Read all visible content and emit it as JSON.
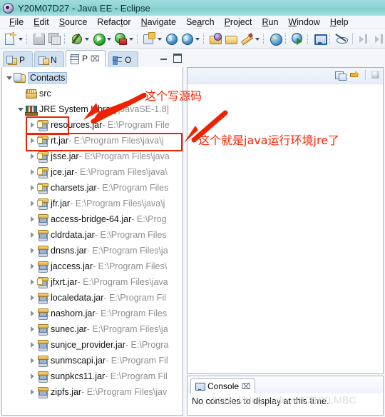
{
  "window": {
    "title": "Y20M07D27 - Java EE - Eclipse",
    "app_icon": "eclipse-icon"
  },
  "menubar": {
    "items": [
      {
        "label": "File",
        "mnemonic": "F"
      },
      {
        "label": "Edit",
        "mnemonic": "E"
      },
      {
        "label": "Source",
        "mnemonic": "S"
      },
      {
        "label": "Refactor",
        "mnemonic": "t"
      },
      {
        "label": "Navigate",
        "mnemonic": "N"
      },
      {
        "label": "Search",
        "mnemonic": "a"
      },
      {
        "label": "Project",
        "mnemonic": "P"
      },
      {
        "label": "Run",
        "mnemonic": "R"
      },
      {
        "label": "Window",
        "mnemonic": "W"
      },
      {
        "label": "Help",
        "mnemonic": "H"
      }
    ]
  },
  "toolbar": {
    "items": [
      {
        "name": "new-file-button",
        "icon": "new-file-icon"
      },
      {
        "name": "new-file-dropdown",
        "icon": "chevron-down-icon"
      },
      {
        "name": "save-button",
        "icon": "save-icon"
      },
      {
        "name": "save-all-button",
        "icon": "save-all-icon"
      },
      {
        "name": "debug-button",
        "icon": "debug-bug-icon"
      },
      {
        "name": "debug-dropdown",
        "icon": "chevron-down-icon"
      },
      {
        "name": "run-button",
        "icon": "run-play-icon"
      },
      {
        "name": "run-dropdown",
        "icon": "chevron-down-icon"
      },
      {
        "name": "run-on-server-button",
        "icon": "run-server-icon"
      },
      {
        "name": "run-on-server-dropdown",
        "icon": "chevron-down-icon"
      },
      {
        "name": "new-web-project-button",
        "icon": "new-web-icon"
      },
      {
        "name": "new-web-project-dropdown",
        "icon": "chevron-down-icon"
      },
      {
        "name": "search-button",
        "icon": "search-globe-icon"
      },
      {
        "name": "search-dropdown",
        "icon": "chevron-down-icon"
      },
      {
        "name": "open-type-button",
        "icon": "open-folder-icon"
      },
      {
        "name": "open-resource-button",
        "icon": "folder-icon"
      },
      {
        "name": "annotation-button",
        "icon": "pencil-icon"
      },
      {
        "name": "annotation-dropdown",
        "icon": "chevron-down-icon"
      },
      {
        "name": "web-browser-button",
        "icon": "globe-icon"
      },
      {
        "name": "external-browser-button",
        "icon": "external-browser-icon"
      },
      {
        "name": "console-button",
        "icon": "monitor-icon"
      },
      {
        "name": "skip-breakpoints-button",
        "icon": "no-watch-icon"
      },
      {
        "name": "step-into-button",
        "icon": "step-into-icon"
      }
    ]
  },
  "left_view": {
    "tabs": [
      {
        "label": "P",
        "icon": "project-explorer-icon",
        "active": false
      },
      {
        "label": "N",
        "icon": "navigator-icon",
        "active": false
      },
      {
        "label": "P",
        "icon": "package-explorer-icon",
        "active": true,
        "close": "⌧"
      },
      {
        "label": "O",
        "icon": "outline-icon",
        "active": false
      }
    ],
    "window_buttons": [
      {
        "name": "minimize-button",
        "icon": "minimize-icon"
      },
      {
        "name": "maximize-button",
        "icon": "maximize-icon"
      }
    ],
    "view_toolbar": [
      {
        "name": "link-with-editor-button",
        "icon": "link-editor-icon"
      },
      {
        "name": "collapse-all-button",
        "icon": "yellow-arrow-icon"
      },
      {
        "name": "view-menu-button",
        "icon": "view-menu-icon"
      }
    ],
    "tree": [
      {
        "indent": 0,
        "arrow": "open",
        "icon": "project-folder-icon",
        "label": "Contacts",
        "path": "",
        "selected": true
      },
      {
        "indent": 1,
        "arrow": "none",
        "icon": "package-folder-icon",
        "label": "src",
        "path": ""
      },
      {
        "indent": 1,
        "arrow": "open",
        "icon": "jre-library-icon",
        "label": "JRE System Library ",
        "path": "[JavaSE-1.8]"
      },
      {
        "indent": 2,
        "arrow": "closed",
        "icon": "jar-signed-icon",
        "label": "resources.jar",
        "path": " - E:\\Program File"
      },
      {
        "indent": 2,
        "arrow": "closed",
        "icon": "jar-signed-icon",
        "label": "rt.jar",
        "path": " - E:\\Program Files\\java\\j"
      },
      {
        "indent": 2,
        "arrow": "closed",
        "icon": "jar-signed-icon",
        "label": "jsse.jar",
        "path": " - E:\\Program Files\\java"
      },
      {
        "indent": 2,
        "arrow": "closed",
        "icon": "jar-signed-icon",
        "label": "jce.jar",
        "path": " - E:\\Program Files\\java\\"
      },
      {
        "indent": 2,
        "arrow": "closed",
        "icon": "jar-signed-icon",
        "label": "charsets.jar",
        "path": " - E:\\Program Files"
      },
      {
        "indent": 2,
        "arrow": "closed",
        "icon": "jar-signed-icon",
        "label": "jfr.jar",
        "path": " - E:\\Program Files\\java\\j"
      },
      {
        "indent": 2,
        "arrow": "closed",
        "icon": "jar-icon",
        "label": "access-bridge-64.jar",
        "path": " - E:\\Prog"
      },
      {
        "indent": 2,
        "arrow": "closed",
        "icon": "jar-icon",
        "label": "cldrdata.jar",
        "path": " - E:\\Program Files"
      },
      {
        "indent": 2,
        "arrow": "closed",
        "icon": "jar-icon",
        "label": "dnsns.jar",
        "path": " - E:\\Program Files\\ja"
      },
      {
        "indent": 2,
        "arrow": "closed",
        "icon": "jar-icon",
        "label": "jaccess.jar",
        "path": " - E:\\Program Files\\"
      },
      {
        "indent": 2,
        "arrow": "closed",
        "icon": "jar-signed-icon",
        "label": "jfxrt.jar",
        "path": " - E:\\Program Files\\java"
      },
      {
        "indent": 2,
        "arrow": "closed",
        "icon": "jar-icon",
        "label": "localedata.jar",
        "path": " - E:\\Program Fil"
      },
      {
        "indent": 2,
        "arrow": "closed",
        "icon": "jar-icon",
        "label": "nashorn.jar",
        "path": " - E:\\Program Files"
      },
      {
        "indent": 2,
        "arrow": "closed",
        "icon": "jar-icon",
        "label": "sunec.jar",
        "path": " - E:\\Program Files\\ja"
      },
      {
        "indent": 2,
        "arrow": "closed",
        "icon": "jar-icon",
        "label": "sunjce_provider.jar",
        "path": " - E:\\Progra"
      },
      {
        "indent": 2,
        "arrow": "closed",
        "icon": "jar-icon",
        "label": "sunmscapi.jar",
        "path": " - E:\\Program Fil"
      },
      {
        "indent": 2,
        "arrow": "closed",
        "icon": "jar-icon",
        "label": "sunpkcs11.jar",
        "path": " - E:\\Program Fil"
      },
      {
        "indent": 2,
        "arrow": "closed",
        "icon": "jar-icon",
        "label": "zipfs.jar",
        "path": " - E:\\Program Files\\jav"
      }
    ]
  },
  "annotations": {
    "note_src": "这个写源码",
    "note_jre": "这个就是java运行环境jre了",
    "color": "#ff2200"
  },
  "console_view": {
    "tab_label": "Console",
    "tab_close": "⌧",
    "tab_icon": "console-icon",
    "message": "No consoles to display at this time."
  },
  "watermark": {
    "text": "https://blog.csdn.net/ZHYLMBC"
  }
}
